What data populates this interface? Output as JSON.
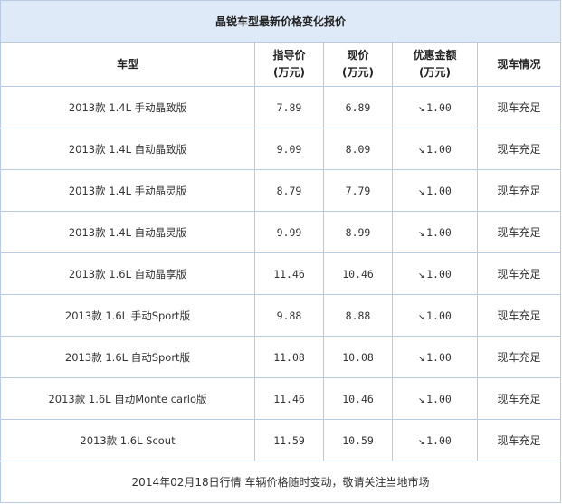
{
  "table": {
    "title": "晶锐车型最新价格变化报价",
    "headers": {
      "model": "车型",
      "guide_price": [
        "指导价",
        "(万元)"
      ],
      "current_price": [
        "现价",
        "(万元)"
      ],
      "discount": [
        "优惠金额",
        "(万元)"
      ],
      "stock": "现车情况"
    },
    "rows": [
      {
        "model": "2013款 1.4L 手动晶致版",
        "guide": "7.89",
        "current": "6.89",
        "arrow": "↘",
        "discount": "1.00",
        "stock": "现车充足"
      },
      {
        "model": "2013款 1.4L 自动晶致版",
        "guide": "9.09",
        "current": "8.09",
        "arrow": "↘",
        "discount": "1.00",
        "stock": "现车充足"
      },
      {
        "model": "2013款 1.4L 手动晶灵版",
        "guide": "8.79",
        "current": "7.79",
        "arrow": "↘",
        "discount": "1.00",
        "stock": "现车充足"
      },
      {
        "model": "2013款 1.4L 自动晶灵版",
        "guide": "9.99",
        "current": "8.99",
        "arrow": "↘",
        "discount": "1.00",
        "stock": "现车充足"
      },
      {
        "model": "2013款 1.6L 自动晶享版",
        "guide": "11.46",
        "current": "10.46",
        "arrow": "↘",
        "discount": "1.00",
        "stock": "现车充足"
      },
      {
        "model": "2013款 1.6L 手动Sport版",
        "guide": "9.88",
        "current": "8.88",
        "arrow": "↘",
        "discount": "1.00",
        "stock": "现车充足"
      },
      {
        "model": "2013款 1.6L 自动Sport版",
        "guide": "11.08",
        "current": "10.08",
        "arrow": "↘",
        "discount": "1.00",
        "stock": "现车充足"
      },
      {
        "model": "2013款 1.6L 自动Monte carlo版",
        "guide": "11.46",
        "current": "10.46",
        "arrow": "↘",
        "discount": "1.00",
        "stock": "现车充足"
      },
      {
        "model": "2013款 1.6L Scout",
        "guide": "11.59",
        "current": "10.59",
        "arrow": "↘",
        "discount": "1.00",
        "stock": "现车充足"
      }
    ],
    "footer": "2014年02月18日行情 车辆价格随时变动，敬请关注当地市场"
  }
}
